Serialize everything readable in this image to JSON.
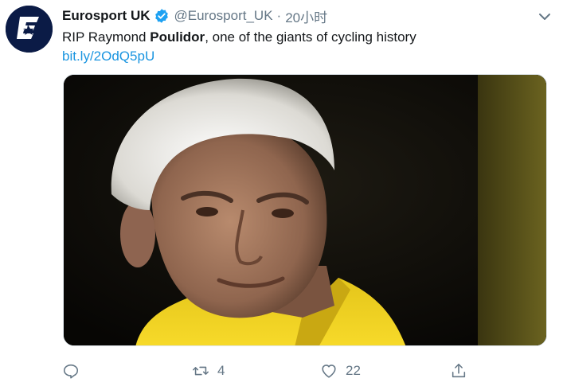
{
  "tweet": {
    "author": {
      "name": "Eurosport UK",
      "handle": "@Eurosport_UK",
      "verified": true,
      "avatar_icon": "eurosport-e-logo"
    },
    "separator": "·",
    "time": "20小时",
    "text_before": "RIP Raymond ",
    "text_bold": "Poulidor",
    "text_after": ", one of the giants of cycling history",
    "link": "bit.ly/2OdQ5pU",
    "media": {
      "description_icon": "portrait-photo",
      "colors": {
        "background": "#0c0b07",
        "shirt": "#f2d21c",
        "hair": "#eceae4",
        "skin": "#a87b62"
      }
    },
    "actions": {
      "reply_icon": "reply-icon",
      "retweet_icon": "retweet-icon",
      "retweet_count": "4",
      "like_icon": "heart-icon",
      "like_count": "22",
      "share_icon": "share-icon"
    }
  },
  "colors": {
    "accent": "#1b95e0",
    "muted": "#657786",
    "text": "#14171a",
    "verified": "#1da1f2"
  }
}
